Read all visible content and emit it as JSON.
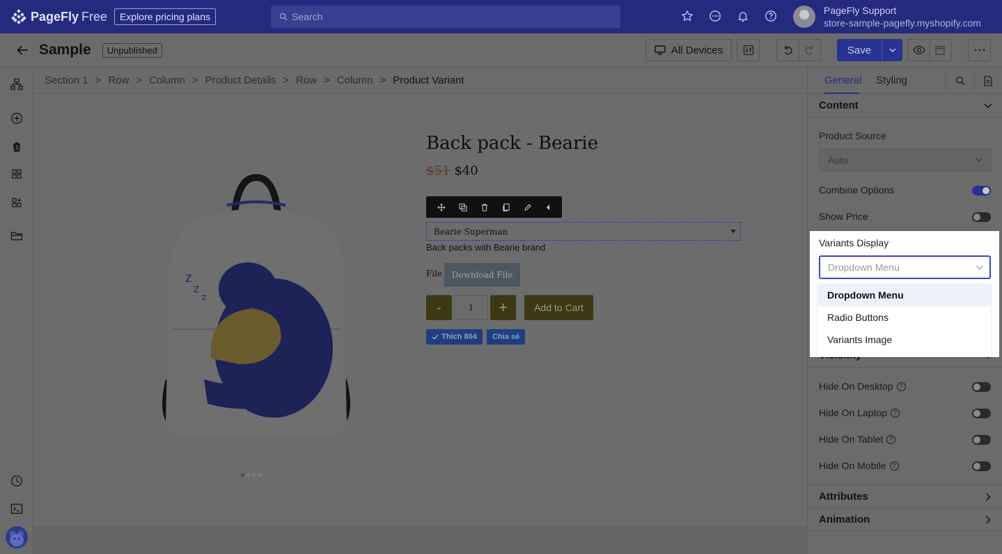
{
  "topbar": {
    "brand": "PageFly",
    "brand_suffix": "Free",
    "pricing_link": "Explore pricing plans",
    "search_placeholder": "Search",
    "user_name": "PageFly Support",
    "user_store": "store-sample-pagefly.myshopify.com"
  },
  "subbar": {
    "page_title": "Sample",
    "status": "Unpublished",
    "devices": "All Devices",
    "save": "Save"
  },
  "breadcrumb": [
    "Section 1",
    "Row",
    "Column",
    "Product Details",
    "Row",
    "Column",
    "Product Variant"
  ],
  "product": {
    "title": "Back pack - Bearie",
    "old_price": "$51",
    "price": "$40",
    "variant": "Bearie Superman",
    "description": "Back packs with Bearie brand",
    "file_label": "File",
    "download": "Download File",
    "minus": "-",
    "quantity": "1",
    "plus": "+",
    "add_to_cart": "Add to Cart",
    "like": "Thích 804",
    "share": "Chia sẻ"
  },
  "panel": {
    "tabs": [
      "General",
      "Styling"
    ],
    "content_title": "Content",
    "product_source_label": "Product Source",
    "product_source_value": "Auto",
    "combine_options": "Combine Options",
    "combine_options_on": true,
    "show_price": "Show Price",
    "show_price_on": false,
    "variants_display_label": "Variants Display",
    "variants_display_placeholder": "Dropdown Menu",
    "variants_display_options": [
      "Dropdown Menu",
      "Radio Buttons",
      "Variants Image"
    ],
    "visibility_title": "Visibility",
    "hide_desktop": "Hide On Desktop",
    "hide_laptop": "Hide On Laptop",
    "hide_tablet": "Hide On Tablet",
    "hide_mobile": "Hide On Mobile",
    "attributes_title": "Attributes",
    "animation_title": "Animation"
  }
}
